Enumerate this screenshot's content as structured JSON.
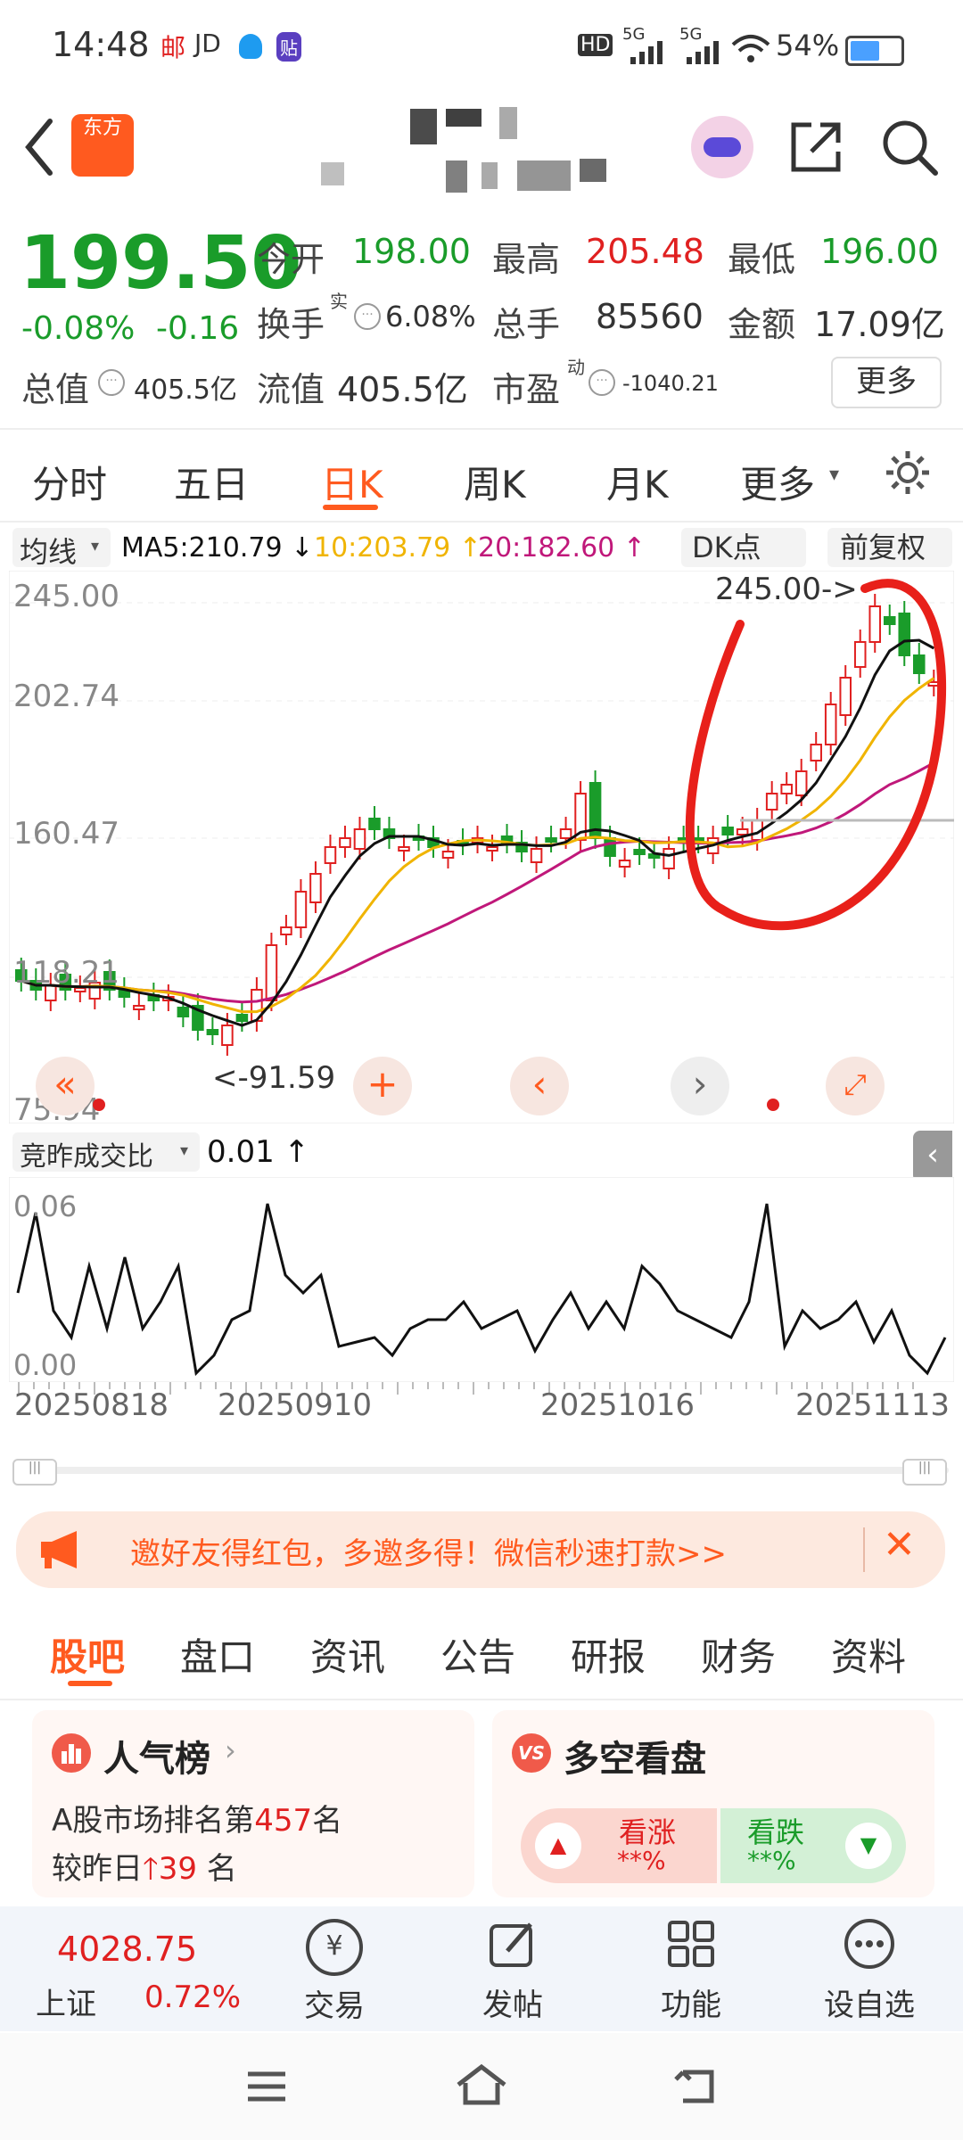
{
  "status_bar": {
    "time": "14:48",
    "notes": [
      "邮",
      "JD",
      "贴"
    ],
    "signals": [
      "HD",
      "5G",
      "5G"
    ],
    "battery": "54%"
  },
  "header": {
    "logo_text": "东方"
  },
  "quote": {
    "price": "199.50",
    "change_pct": "-0.08%",
    "change": "-0.16",
    "open_label": "今开",
    "open": "198.00",
    "high_label": "最高",
    "high": "205.48",
    "low_label": "最低",
    "low": "196.00",
    "turnover_label": "换手",
    "turnover_sup": "实",
    "turnover": "6.08%",
    "volume_label": "总手",
    "volume": "85560",
    "amount_label": "金额",
    "amount": "17.09亿",
    "mktcap_label": "总值",
    "mktcap": "405.5亿",
    "float_label": "流值",
    "float_value": "405.5亿",
    "pe_label": "市盈",
    "pe_sup": "动",
    "pe": "-1040.21",
    "more_button": "更多"
  },
  "chart_tabs": [
    "分时",
    "五日",
    "日K",
    "周K",
    "月K",
    "更多"
  ],
  "ma_bar": {
    "selector": "均线",
    "ma5": "MA5:210.79 ↓",
    "ma10": "10:203.79 ↑",
    "ma20": "20:182.60 ↑",
    "dk_button": "DK点",
    "adjust_button": "前复权"
  },
  "kchart_labels": {
    "y_ticks": [
      "245.00",
      "202.74",
      "160.47",
      "118.21",
      "75.94"
    ],
    "high_marker": "245.00->",
    "low_marker": "<-91.59"
  },
  "vol_header": {
    "selector": "竞昨成交比",
    "value": "0.01 ↑"
  },
  "vol_labels": {
    "y_ticks": [
      "0.06",
      "0.00"
    ],
    "x_dates": [
      "20250818",
      "20250910",
      "20251016",
      "20251113"
    ]
  },
  "banner": {
    "text": "邀好友得红包，多邀多得！微信秒速打款>>"
  },
  "section_tabs": [
    "股吧",
    "盘口",
    "资讯",
    "公告",
    "研报",
    "财务",
    "资料"
  ],
  "popularity": {
    "title": "人气榜",
    "line1_prefix": "A股市场排名第",
    "rank": "457",
    "line1_suffix": "名",
    "line2_prefix": "较昨日",
    "rank_change": "39",
    "line2_suffix": "名"
  },
  "sentiment": {
    "badge": "VS",
    "title": "多空看盘",
    "bull_label": "看涨",
    "bull_value": "**%",
    "bear_label": "看跌",
    "bear_value": "**%"
  },
  "bottom_nav": {
    "index_value": "4028.75",
    "index_name": "上证",
    "index_change": "0.72%",
    "items": [
      "交易",
      "发帖",
      "功能",
      "设自选"
    ]
  },
  "colors": {
    "up": "#e02020",
    "down": "#1a9c2a",
    "accent": "#ff5a1f",
    "ma5": "#111111",
    "ma10": "#f0b400",
    "ma20": "#c0187a"
  }
}
